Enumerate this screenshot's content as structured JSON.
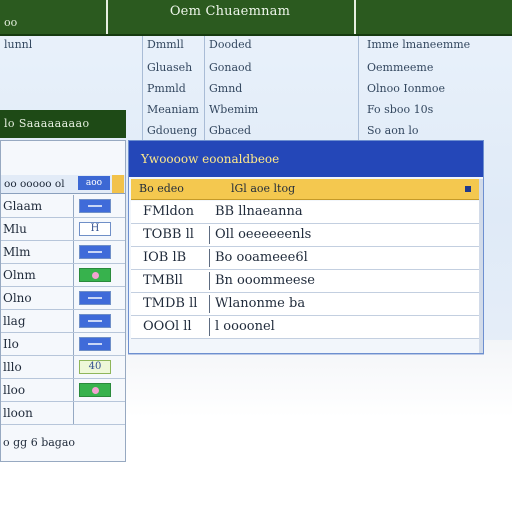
{
  "ribbon": {
    "title": "Oem Chuaemnam",
    "left_label": "oo",
    "accent": "#2b5a1f"
  },
  "sheet": {
    "col_a": [
      "lunnl"
    ],
    "col_b": [
      "Dmmll",
      "Gluaseh",
      "Pmmld",
      "Meaniam",
      "Gdoueng"
    ],
    "col_c": [
      "Dooded",
      "Gonaod",
      "Gmnd",
      "Wbemim",
      "Gbaced"
    ],
    "col_d": [
      "Imme lmaneemme",
      "Oemmeeme",
      "Olnoo Ionmoe",
      "Fo sboo 10s",
      "So aon lo"
    ]
  },
  "left_panel": {
    "header": "lo Saaaaaaaao",
    "header_row": {
      "label": "oo ooooo ol",
      "badge": "aoo"
    },
    "rows": [
      {
        "label": "Glaam",
        "badge": "blue",
        "badge_text": ""
      },
      {
        "label": "Mlu",
        "badge": "letter",
        "badge_text": "H"
      },
      {
        "label": "Mlm",
        "badge": "blue",
        "badge_text": ""
      },
      {
        "label": "Olnm",
        "badge": "green",
        "badge_text": ""
      },
      {
        "label": "Olno",
        "badge": "blue",
        "badge_text": ""
      },
      {
        "label": "llag",
        "badge": "blue",
        "badge_text": ""
      },
      {
        "label": "Ilo",
        "badge": "blue",
        "badge_text": ""
      },
      {
        "label": "lllo",
        "badge": "letter",
        "badge_text": "40"
      },
      {
        "label": "lloo",
        "badge": "green",
        "badge_text": ""
      },
      {
        "label": "lloon",
        "badge": "none",
        "badge_text": ""
      }
    ],
    "footer": "o gg 6 bagao"
  },
  "dialog": {
    "title": "Ywoooow eoonaldbeoe",
    "selected": {
      "key": "Bo edeo",
      "value": "lGl aoe ltog"
    },
    "rows": [
      {
        "key": "FMldon",
        "value": "BB llnaeanna"
      },
      {
        "key": "TOBB ll",
        "value": "Oll oeeeeeenls"
      },
      {
        "key": "IOB lB",
        "value": "Bo ooameee6l"
      },
      {
        "key": "TMBll",
        "value": "Bn ooommeese"
      },
      {
        "key": "TMDB ll",
        "value": "Wlanonme ba"
      },
      {
        "key": "OOOl ll",
        "value": "l oooonel"
      }
    ],
    "title_color": "#2447b8",
    "highlight_color": "#f4c84f"
  }
}
